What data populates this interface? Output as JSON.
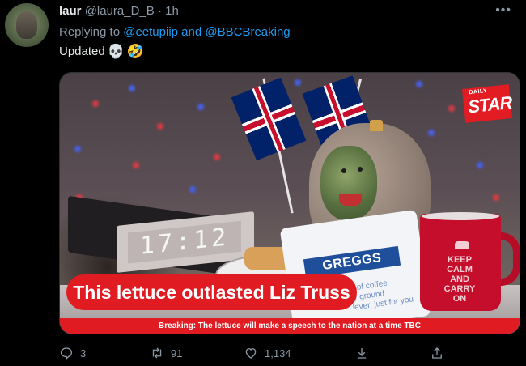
{
  "tweet": {
    "author_name": "laur",
    "author_handle": "@laura_D_B",
    "separator": "·",
    "time": "1h",
    "more_icon": "more-dots-icon",
    "reply_prefix": "Replying to",
    "reply_mention_1": "@eetupiip",
    "reply_connector": "and",
    "reply_mention_2": "@BBCBreaking",
    "text": "Updated",
    "emoji_1": "💀",
    "emoji_2": "🤣"
  },
  "media": {
    "logo_small": "DAILY",
    "logo_main": "STAR",
    "caption": "This lettuce outlasted Liz Truss",
    "ticker": "Breaking: The lettuce will make a speech to the nation at a time TBC",
    "clock_display": "17:12",
    "bag_brand": "GREGGS",
    "bag_text": "o of coffee\nly ground\nlever, just for you",
    "mug_text": "KEEP\nCALM\nAND\nCARRY\nON"
  },
  "actions": {
    "reply_count": "3",
    "retweet_count": "91",
    "like_count": "1,134",
    "icons": [
      "reply-icon",
      "retweet-icon",
      "like-icon",
      "download-icon",
      "share-icon"
    ]
  },
  "colors": {
    "background": "#000000",
    "link_blue": "#1d9bf0",
    "secondary_text": "#8b98a5",
    "caption_red": "#e11b22"
  }
}
